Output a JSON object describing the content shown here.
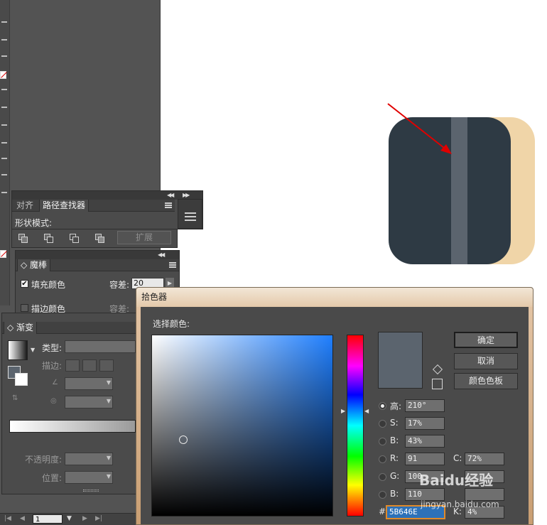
{
  "align_panel": {
    "tabs": [
      "对齐",
      "路径查找器"
    ],
    "shape_modes_label": "形状模式:",
    "expand_button": "扩展"
  },
  "magic_wand_panel": {
    "tab": "魔棒",
    "fill_color_label": "填充颜色",
    "fill_checked": "✔",
    "tolerance_label": "容差:",
    "tolerance_value": "20",
    "stroke_color_label": "描边颜色",
    "stroke_tolerance_label": "容差:"
  },
  "gradient_panel": {
    "tab": "渐变",
    "type_label": "类型:",
    "stroke_label": "描边:",
    "opacity_label": "不透明度:",
    "position_label": "位置:"
  },
  "status_bar": {
    "page": "1"
  },
  "color_picker": {
    "title": "拾色器",
    "select_color_label": "选择颜色:",
    "ok_button": "确定",
    "cancel_button": "取消",
    "swatches_button": "颜色色板",
    "fields": {
      "h_label": "高:",
      "h_value": "210°",
      "s_label": "S:",
      "s_value": "17%",
      "b_label": "B:",
      "b_value": "43%",
      "r_label": "R:",
      "r_value": "91",
      "g_label": "G:",
      "g_value": "100",
      "bl_label": "B:",
      "bl_value": "110",
      "c_label": "C:",
      "c_value": "72%",
      "k_label": "K:",
      "k_value": "4%",
      "hash_label": "#",
      "hex_value": "5B646E"
    }
  },
  "watermark": {
    "brand": "Baidu经验",
    "url": "jingyan.baidu.com"
  },
  "colors": {
    "selected": "#5B646E",
    "shape_dark": "#2E3A44",
    "shape_back": "#F0D5A8",
    "arrow": "#E00000"
  }
}
